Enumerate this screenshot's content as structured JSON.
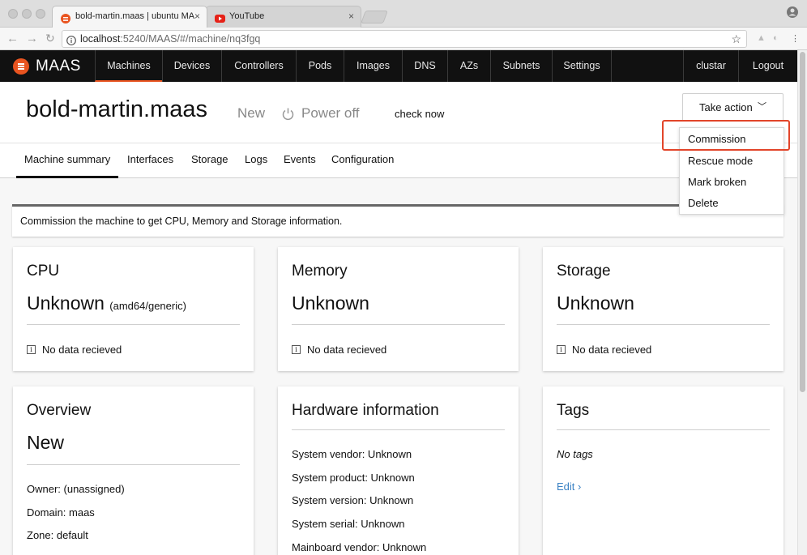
{
  "browser": {
    "tabs": [
      {
        "title": "bold-martin.maas | ubuntu MA",
        "close": "×"
      },
      {
        "title": "YouTube",
        "close": "×"
      }
    ],
    "url_host": "localhost",
    "url_path": ":5240/MAAS/#/machine/nq3fgq"
  },
  "nav": {
    "logo": "MAAS",
    "items": [
      "Machines",
      "Devices",
      "Controllers",
      "Pods",
      "Images",
      "DNS",
      "AZs",
      "Subnets",
      "Settings"
    ],
    "user": "clustar",
    "logout": "Logout"
  },
  "header": {
    "hostname": "bold-martin.maas",
    "status": "New",
    "power": "Power off",
    "check_now": "check now",
    "take_action": "Take action"
  },
  "actions_menu": [
    "Commission",
    "Rescue mode",
    "Mark broken",
    "Delete"
  ],
  "subtabs": [
    "Machine summary",
    "Interfaces",
    "Storage",
    "Logs",
    "Events",
    "Configuration"
  ],
  "notice": "Commission the machine to get CPU, Memory and Storage information.",
  "cards": {
    "cpu": {
      "title": "CPU",
      "value": "Unknown",
      "sub": "(amd64/generic)",
      "nodata": "No data recieved"
    },
    "memory": {
      "title": "Memory",
      "value": "Unknown",
      "nodata": "No data recieved"
    },
    "storage": {
      "title": "Storage",
      "value": "Unknown",
      "nodata": "No data recieved"
    },
    "overview": {
      "title": "Overview",
      "value": "New",
      "owner": "Owner: (unassigned)",
      "domain": "Domain: maas",
      "zone": "Zone: default"
    },
    "hardware": {
      "title": "Hardware information",
      "lines": [
        "System vendor: Unknown",
        "System product: Unknown",
        "System version: Unknown",
        "System serial: Unknown",
        "Mainboard vendor: Unknown"
      ]
    },
    "tags": {
      "title": "Tags",
      "empty": "No tags",
      "edit": "Edit ›"
    }
  },
  "colors": {
    "accent": "#e95420",
    "nav_bg": "#111111",
    "highlight": "#e2452a",
    "link": "#3b82c4"
  }
}
